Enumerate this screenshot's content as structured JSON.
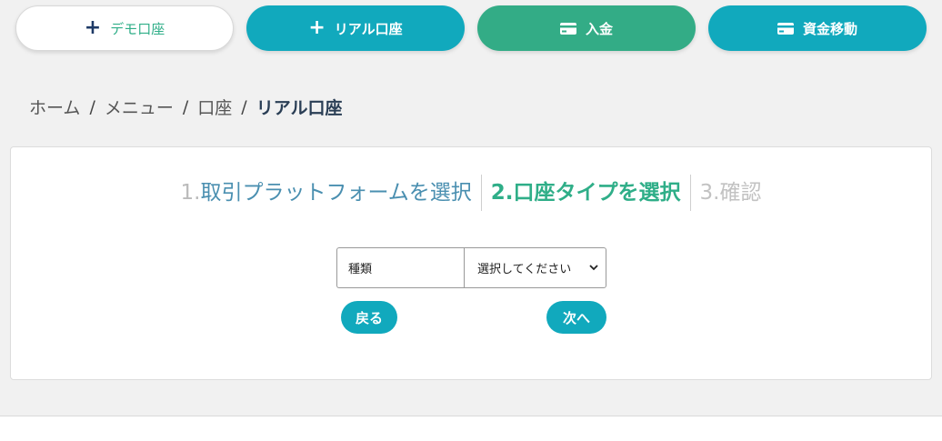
{
  "top_buttons": {
    "demo": "デモ口座",
    "real": "リアル口座",
    "deposit": "入金",
    "transfer": "資金移動"
  },
  "breadcrumb": {
    "home": "ホーム",
    "menu": "メニュー",
    "account": "口座",
    "current": "リアル口座",
    "separator": "/"
  },
  "steps": {
    "step1_num": "1.",
    "step1_label": "取引プラットフォームを選択",
    "step2_num": "2.",
    "step2_label": "口座タイプを選択",
    "step3_num": "3.",
    "step3_label": "確認"
  },
  "form": {
    "type_label": "種類",
    "type_select_value": "選択してください"
  },
  "actions": {
    "back": "戻る",
    "next": "次へ"
  },
  "colors": {
    "teal": "#11a9bd",
    "green": "#33ac86",
    "step_active": "#2fae88"
  }
}
